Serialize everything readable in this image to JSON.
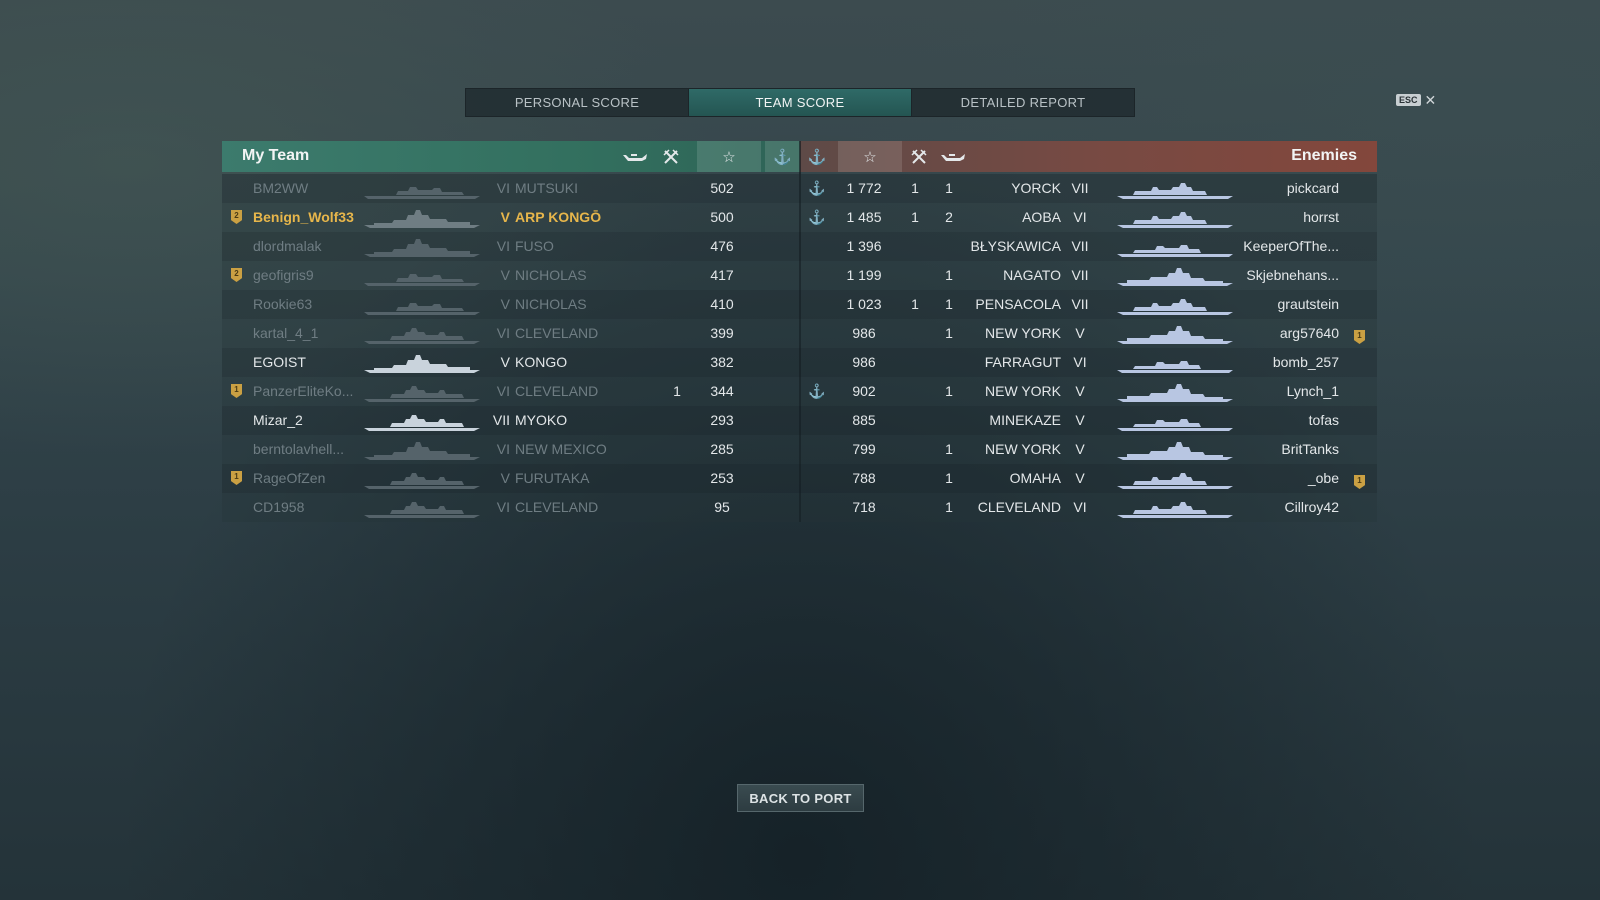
{
  "tabs": [
    {
      "label": "PERSONAL SCORE",
      "active": false
    },
    {
      "label": "TEAM SCORE",
      "active": true
    },
    {
      "label": "DETAILED REPORT",
      "active": false
    }
  ],
  "esc": {
    "key": "ESC",
    "close_glyph": "✕"
  },
  "my_team": {
    "title": "My Team",
    "header_icons": {
      "planes": "plane-icon",
      "kills": "crossed-swords-icon",
      "score": "star-icon",
      "base": "anchor-icon"
    },
    "rows": [
      {
        "player": "BM2WW",
        "tier": "VI",
        "ship": "MUTSUKI",
        "kills": "",
        "score": "502",
        "anchor": false,
        "badge": "",
        "status": "dead",
        "ship_icon": "destroyer-icon"
      },
      {
        "player": "Benign_Wolf33",
        "tier": "V",
        "ship": "ARP KONGŌ",
        "kills": "",
        "score": "500",
        "anchor": false,
        "badge": "2",
        "status": "me",
        "ship_icon": "battleship-icon"
      },
      {
        "player": "dlordmalak",
        "tier": "VI",
        "ship": "FUSO",
        "kills": "",
        "score": "476",
        "anchor": false,
        "badge": "",
        "status": "dead",
        "ship_icon": "battleship-icon"
      },
      {
        "player": "geofigris9",
        "tier": "V",
        "ship": "NICHOLAS",
        "kills": "",
        "score": "417",
        "anchor": false,
        "badge": "2",
        "status": "dead",
        "ship_icon": "destroyer-icon"
      },
      {
        "player": "Rookie63",
        "tier": "V",
        "ship": "NICHOLAS",
        "kills": "",
        "score": "410",
        "anchor": false,
        "badge": "",
        "status": "dead",
        "ship_icon": "destroyer-icon"
      },
      {
        "player": "kartal_4_1",
        "tier": "VI",
        "ship": "CLEVELAND",
        "kills": "",
        "score": "399",
        "anchor": false,
        "badge": "",
        "status": "dead",
        "ship_icon": "cruiser-icon"
      },
      {
        "player": "EGOIST",
        "tier": "V",
        "ship": "KONGO",
        "kills": "",
        "score": "382",
        "anchor": false,
        "badge": "",
        "status": "alive",
        "ship_icon": "battleship-icon"
      },
      {
        "player": "PanzerEliteKo...",
        "tier": "VI",
        "ship": "CLEVELAND",
        "kills": "1",
        "score": "344",
        "anchor": false,
        "badge": "1",
        "status": "dead",
        "ship_icon": "cruiser-icon"
      },
      {
        "player": "Mizar_2",
        "tier": "VII",
        "ship": "MYOKO",
        "kills": "",
        "score": "293",
        "anchor": false,
        "badge": "",
        "status": "alive",
        "ship_icon": "cruiser-icon"
      },
      {
        "player": "berntolavhell...",
        "tier": "VI",
        "ship": "NEW MEXICO",
        "kills": "",
        "score": "285",
        "anchor": false,
        "badge": "",
        "status": "dead",
        "ship_icon": "battleship-icon"
      },
      {
        "player": "RageOfZen",
        "tier": "V",
        "ship": "FURUTAKA",
        "kills": "",
        "score": "253",
        "anchor": false,
        "badge": "1",
        "status": "dead",
        "ship_icon": "cruiser-icon"
      },
      {
        "player": "CD1958",
        "tier": "VI",
        "ship": "CLEVELAND",
        "kills": "",
        "score": "95",
        "anchor": false,
        "badge": "",
        "status": "dead",
        "ship_icon": "cruiser-icon"
      }
    ]
  },
  "enemies": {
    "title": "Enemies",
    "header_icons": {
      "base": "anchor-icon",
      "score": "star-icon",
      "kills": "crossed-swords-icon",
      "planes": "plane-icon"
    },
    "rows": [
      {
        "player": "pickcard",
        "tier": "VII",
        "ship": "YORCK",
        "anchor": true,
        "score": "1 772",
        "kills": "1",
        "planes": "1",
        "badge": "",
        "ship_icon": "cruiser-icon"
      },
      {
        "player": "horrst",
        "tier": "VI",
        "ship": "AOBA",
        "anchor": true,
        "score": "1 485",
        "kills": "1",
        "planes": "2",
        "badge": "",
        "ship_icon": "cruiser-icon"
      },
      {
        "player": "KeeperOfThe...",
        "tier": "VII",
        "ship": "BŁYSKAWICA",
        "anchor": false,
        "score": "1 396",
        "kills": "",
        "planes": "",
        "badge": "",
        "ship_icon": "destroyer-icon"
      },
      {
        "player": "Skjebnehans...",
        "tier": "VII",
        "ship": "NAGATO",
        "anchor": false,
        "score": "1 199",
        "kills": "",
        "planes": "1",
        "badge": "",
        "ship_icon": "battleship-icon"
      },
      {
        "player": "grautstein",
        "tier": "VII",
        "ship": "PENSACOLA",
        "anchor": false,
        "score": "1 023",
        "kills": "1",
        "planes": "1",
        "badge": "",
        "ship_icon": "cruiser-icon"
      },
      {
        "player": "arg57640",
        "tier": "V",
        "ship": "NEW YORK",
        "anchor": false,
        "score": "986",
        "kills": "",
        "planes": "1",
        "badge": "1",
        "ship_icon": "battleship-icon"
      },
      {
        "player": "bomb_257",
        "tier": "VI",
        "ship": "FARRAGUT",
        "anchor": false,
        "score": "986",
        "kills": "",
        "planes": "",
        "badge": "",
        "ship_icon": "destroyer-icon"
      },
      {
        "player": "Lynch_1",
        "tier": "V",
        "ship": "NEW YORK",
        "anchor": true,
        "score": "902",
        "kills": "",
        "planes": "1",
        "badge": "",
        "ship_icon": "battleship-icon"
      },
      {
        "player": "tofas",
        "tier": "V",
        "ship": "MINEKAZE",
        "anchor": false,
        "score": "885",
        "kills": "",
        "planes": "",
        "badge": "",
        "ship_icon": "destroyer-icon"
      },
      {
        "player": "BritTanks",
        "tier": "V",
        "ship": "NEW YORK",
        "anchor": false,
        "score": "799",
        "kills": "",
        "planes": "1",
        "badge": "",
        "ship_icon": "battleship-icon"
      },
      {
        "player": "_obe",
        "tier": "V",
        "ship": "OMAHA",
        "anchor": false,
        "score": "788",
        "kills": "",
        "planes": "1",
        "badge": "1",
        "ship_icon": "cruiser-icon"
      },
      {
        "player": "Cillroy42",
        "tier": "VI",
        "ship": "CLEVELAND",
        "anchor": false,
        "score": "718",
        "kills": "",
        "planes": "1",
        "badge": "",
        "ship_icon": "cruiser-icon"
      }
    ]
  },
  "footer": {
    "back_label": "BACK TO PORT"
  },
  "colors": {
    "my_team_header": "#3c7b6d",
    "enemy_header": "#83473c",
    "active_tab": "#2f6a67",
    "highlight_player": "#e7b64b",
    "dead_text": "#6f7d83",
    "badge": "#caa043"
  }
}
